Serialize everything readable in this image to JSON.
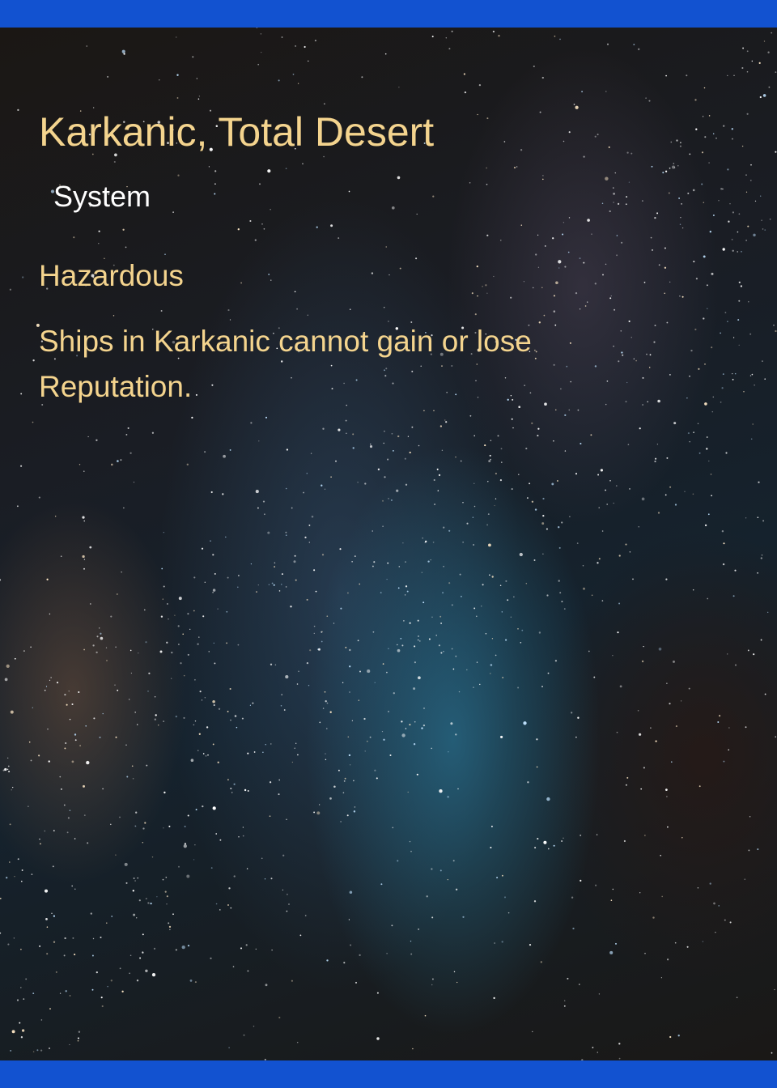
{
  "card": {
    "name": "Karkanic, Total Desert",
    "type": "System",
    "keyword": "Hazardous",
    "rules_text": "Ships in Karkanic cannot gain or lose Reputation."
  },
  "colors": {
    "frame": "#1252d0",
    "title_text": "#f4d48e",
    "subtitle_text": "#ffffff"
  }
}
